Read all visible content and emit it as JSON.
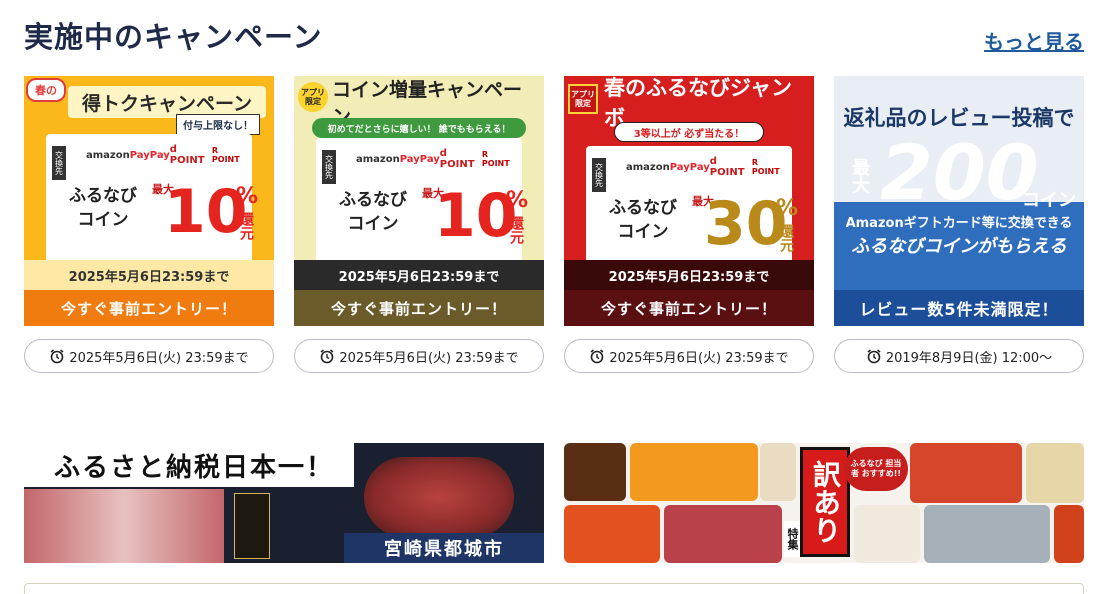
{
  "header": {
    "title": "実施中のキャンペーン",
    "more_link": "もっと見る"
  },
  "campaigns": [
    {
      "tag": "春の",
      "title": "得トクキャンペーン",
      "sub": "付与上限なし！",
      "koukan": "交換先",
      "logos": [
        "amazon",
        "PayPay",
        "d POINT",
        "R POINT"
      ],
      "coin": "ふるなび コイン",
      "max": "最大",
      "percent": "10",
      "percent_sign": "%",
      "kangen": "還元",
      "deadline": "2025年5月6日23:59まで",
      "label": "今すぐ事前エントリー！",
      "pill_text": "2025年5月6日(火) 23:59まで"
    },
    {
      "tag": "アプリ 限定",
      "title": "コイン増量キャンペーン",
      "band": "初めてだとさらに嬉しい！ 誰でももらえる！",
      "koukan": "交換先",
      "logos": [
        "amazon",
        "PayPay",
        "d POINT",
        "R POINT"
      ],
      "coin": "ふるなび コイン",
      "max": "最大",
      "percent": "10",
      "percent_sign": "%",
      "kangen": "還元",
      "deadline": "2025年5月6日23:59まで",
      "label": "今すぐ事前エントリー！",
      "pill_text": "2025年5月6日(火) 23:59まで"
    },
    {
      "tag": "アプリ 限定",
      "title": "春のふるなびジャンボ",
      "band": "3等以上が 必ず当たる！",
      "koukan": "交換先",
      "logos": [
        "amazon",
        "PayPay",
        "d POINT",
        "R POINT"
      ],
      "coin": "ふるなび コイン",
      "max": "最大",
      "percent": "30",
      "percent_sign": "%",
      "kangen": "還元",
      "deadline": "2025年5月6日23:59まで",
      "label": "今すぐ事前エントリー！",
      "pill_text": "2025年5月6日(火) 23:59まで"
    },
    {
      "line1": "返礼品のレビュー投稿で",
      "max": "最大",
      "number": "200",
      "unit": "コイン",
      "line3": "Amazonギフトカード等に交換できる",
      "line4": "ふるなびコインがもらえる",
      "label": "レビュー数5件未満限定！",
      "pill_text": "2019年8月9日(金) 12:00〜"
    }
  ],
  "promo_left": {
    "title": "ふるさと納税日本一！",
    "region": "宮崎県都城市"
  },
  "promo_right": {
    "wake": "訳あり",
    "toku": "特集",
    "badge": "ふるなび 担当者 おすすめ!!"
  },
  "colors": {
    "title": "#1e2a47",
    "link": "#1e5a9c"
  }
}
